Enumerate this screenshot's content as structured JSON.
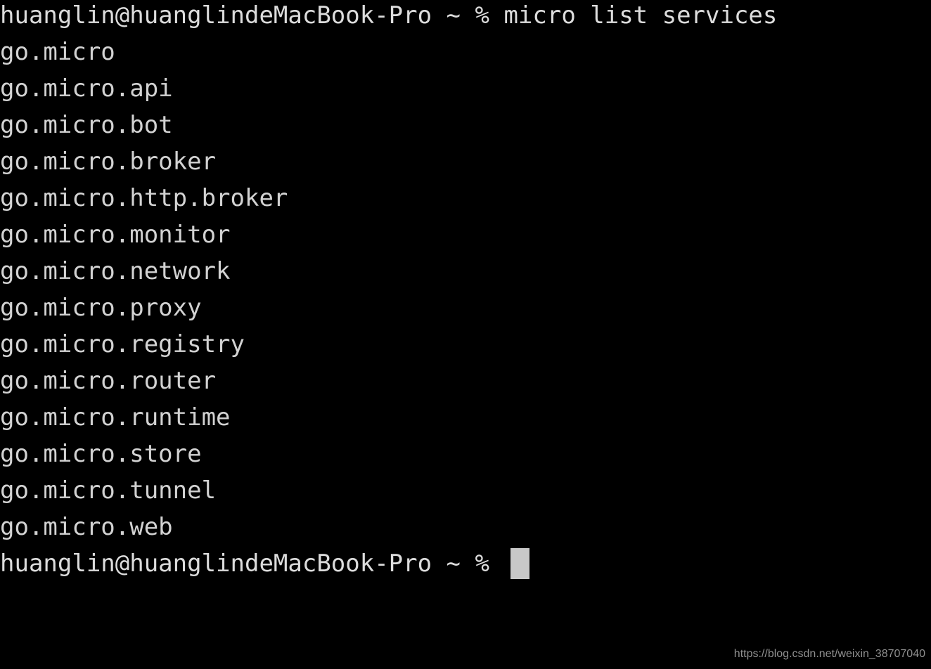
{
  "terminal": {
    "background_color": "#000000",
    "foreground_color": "#d6d6d6",
    "cursor_color": "#c8c8c8",
    "prompt_user_host": "huanglin@huanglindeMacBook-Pro",
    "prompt_cwd": "~",
    "prompt_symbol": "%",
    "command_line": "huanglin@huanglindeMacBook-Pro ~ % micro list services",
    "command": "micro list services",
    "final_prompt": "huanglin@huanglindeMacBook-Pro ~ % ",
    "cursor": {
      "name": "block-cursor",
      "visible": true
    },
    "output": [
      "go.micro",
      "go.micro.api",
      "go.micro.bot",
      "go.micro.broker",
      "go.micro.http.broker",
      "go.micro.monitor",
      "go.micro.network",
      "go.micro.proxy",
      "go.micro.registry",
      "go.micro.router",
      "go.micro.runtime",
      "go.micro.store",
      "go.micro.tunnel",
      "go.micro.web"
    ]
  },
  "watermark": {
    "text": "https://blog.csdn.net/weixin_38707040"
  }
}
